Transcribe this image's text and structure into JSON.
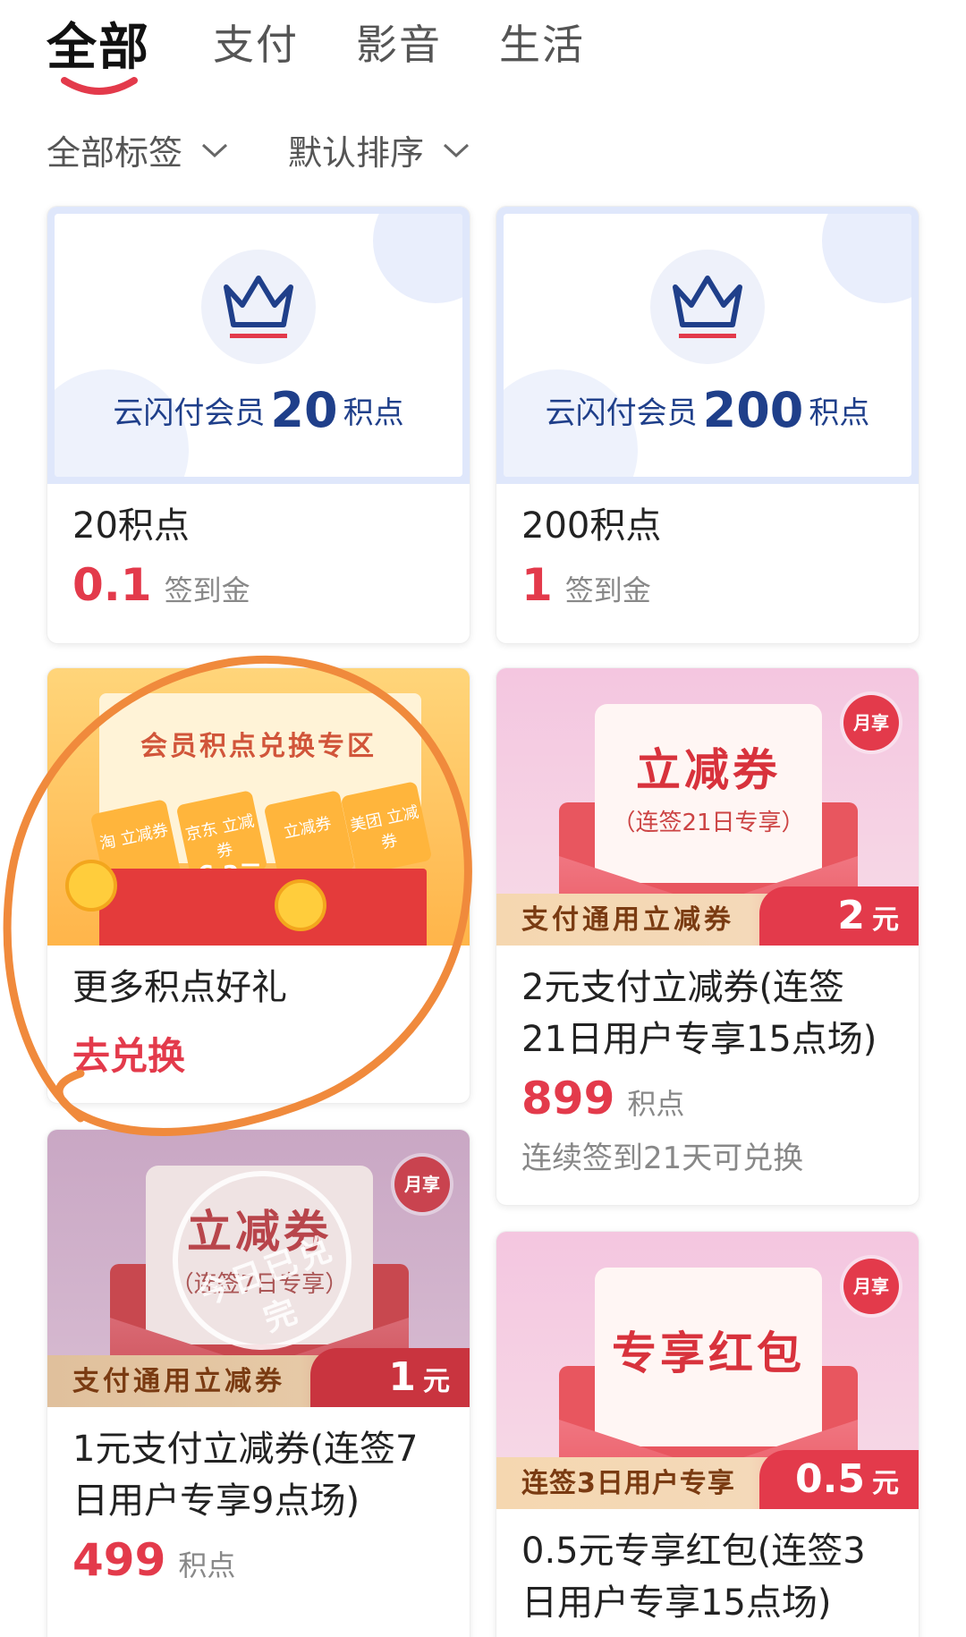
{
  "tabs": [
    {
      "label": "全部",
      "active": true
    },
    {
      "label": "支付",
      "active": false
    },
    {
      "label": "影音",
      "active": false
    },
    {
      "label": "生活",
      "active": false
    }
  ],
  "filters": {
    "tag": "全部标签",
    "sort": "默认排序"
  },
  "colors": {
    "accent": "#e33a4b",
    "member_blue": "#1f3f8a",
    "scribble": "#f08a3c"
  },
  "cards": [
    {
      "banner_prefix": "云闪付会员",
      "banner_amount": "20",
      "banner_suffix": "积点",
      "title": "20积点",
      "price": "0.1",
      "unit": "签到金"
    },
    {
      "banner_prefix": "云闪付会员",
      "banner_amount": "200",
      "banner_suffix": "积点",
      "title": "200积点",
      "price": "1",
      "unit": "签到金"
    },
    {
      "banner_title": "会员积点兑换专区",
      "mini_tickets": [
        "淘 立减券",
        "京东 立减券",
        "立减券",
        "美团 立减券"
      ],
      "mini_amount": "6.2元",
      "title": "更多积点好礼",
      "action": "去兑换"
    },
    {
      "ticket_big": "立减券",
      "ticket_small": "（连签21日专享）",
      "badge": "月享",
      "ribbon_label": "支付通用立减券",
      "ribbon_amount": "2",
      "ribbon_currency": "元",
      "title_line1": "2元支付立减券(连签",
      "title_line2": "21日用户专享15点场)",
      "price": "899",
      "unit": "积点",
      "note": "连续签到21天可兑换"
    },
    {
      "ticket_big": "立减券",
      "ticket_small": "（连签7日专享）",
      "badge": "月享",
      "stamp": "今日已兑完",
      "ribbon_label": "支付通用立减券",
      "ribbon_amount": "1",
      "ribbon_currency": "元",
      "title_line1": "1元支付立减券(连签7",
      "title_line2": "日用户专享9点场)",
      "price": "499",
      "unit": "积点"
    },
    {
      "ticket_big": "专享红包",
      "badge": "月享",
      "ribbon_label": "连签3日用户专享",
      "ribbon_amount": "0.5",
      "ribbon_currency": "元",
      "title_line1": "0.5元专享红包(连签3",
      "title_line2": "日用户专享15点场)"
    }
  ]
}
